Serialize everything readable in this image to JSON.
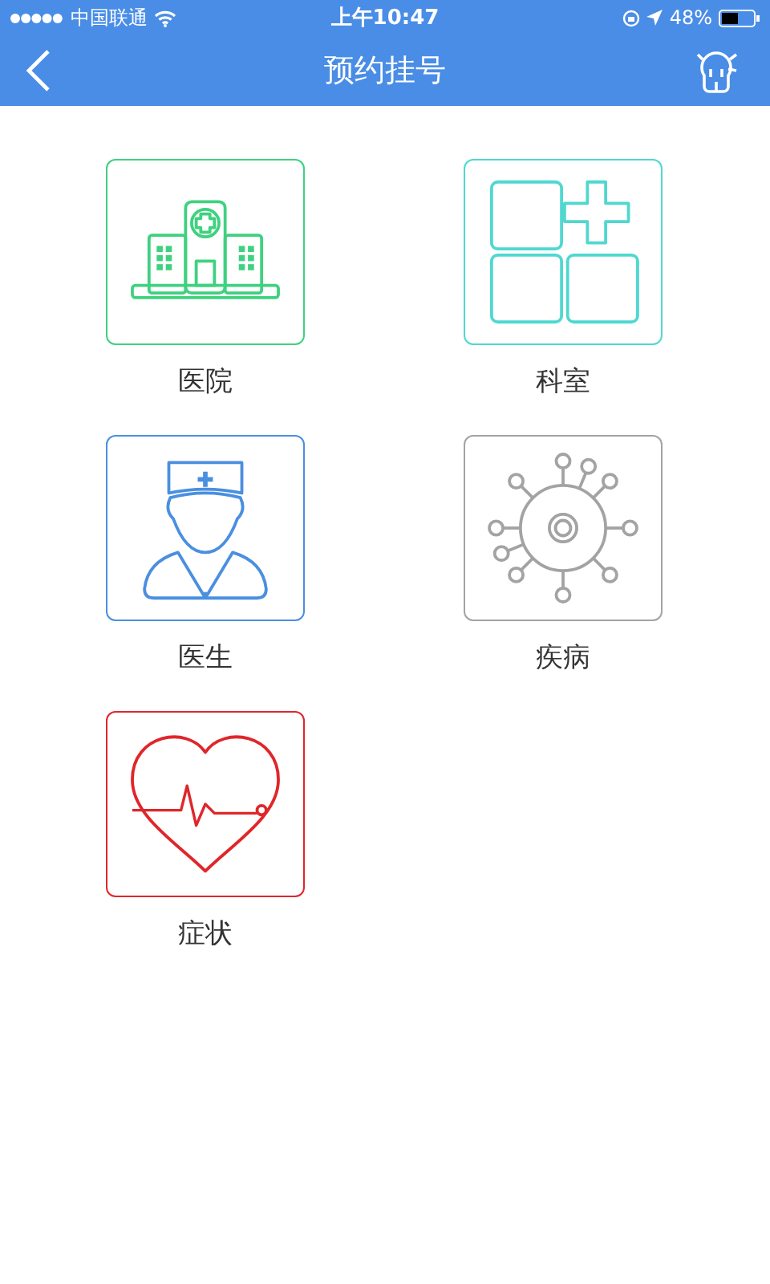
{
  "status_bar": {
    "carrier": "中国联通",
    "time": "上午10:47",
    "battery": "48%"
  },
  "nav_bar": {
    "title": "预约挂号"
  },
  "tiles": [
    {
      "kind": "hospital",
      "label": "医院",
      "color": "#3fd17f"
    },
    {
      "kind": "department",
      "label": "科室",
      "color": "#4fd8d0"
    },
    {
      "kind": "doctor",
      "label": "医生",
      "color": "#4a8fe0"
    },
    {
      "kind": "disease",
      "label": "疾病",
      "color": "#a3a3a3"
    },
    {
      "kind": "symptom",
      "label": "症状",
      "color": "#e0262a"
    }
  ]
}
